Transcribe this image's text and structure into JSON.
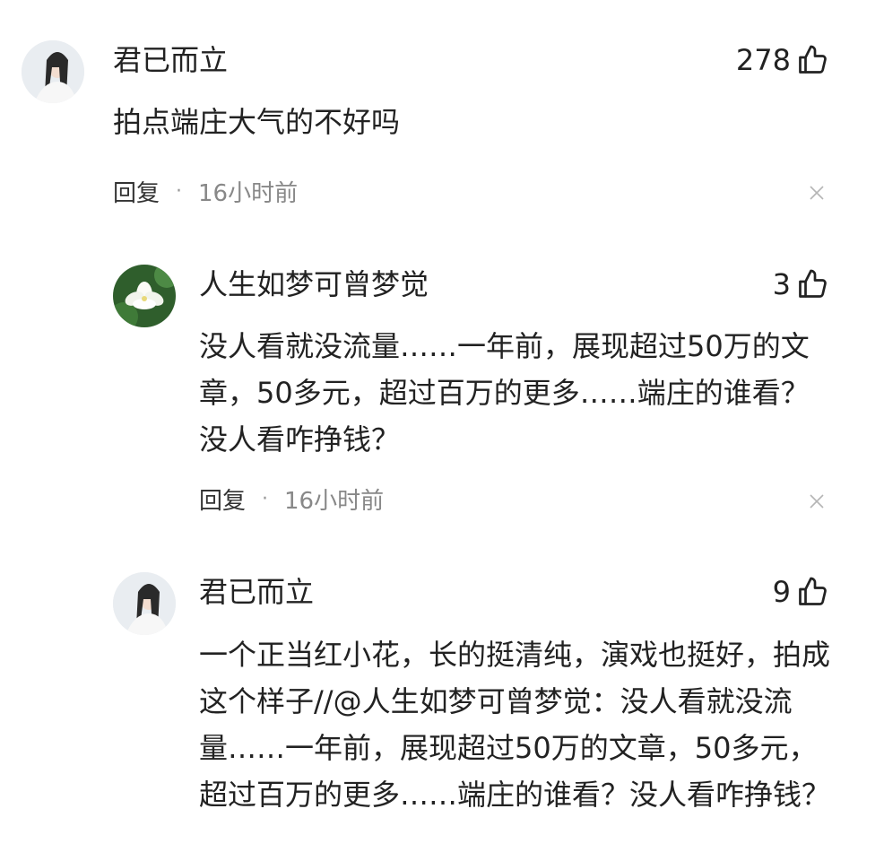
{
  "comments": [
    {
      "author": "君已而立",
      "likes": "278",
      "text": "拍点端庄大气的不好吗",
      "reply_label": "回复",
      "separator": "·",
      "time": "16小时前",
      "avatar_icon": "user-avatar"
    },
    {
      "author": "人生如梦可曾梦觉",
      "likes": "3",
      "text": "没人看就没流量……一年前，展现超过50万的文章，50多元，超过百万的更多……端庄的谁看？没人看咋挣钱？",
      "reply_label": "回复",
      "separator": "·",
      "time": "16小时前",
      "avatar_icon": "lotus-avatar"
    },
    {
      "author": "君已而立",
      "likes": "9",
      "text": "一个正当红小花，长的挺清纯，演戏也挺好，拍成这个样子//@人生如梦可曾梦觉：没人看就没流量……一年前，展现超过50万的文章，50多元，超过百万的更多……端庄的谁看？没人看咋挣钱？",
      "avatar_icon": "user-avatar"
    }
  ],
  "icons": {
    "like": "thumbs-up-icon",
    "close": "close-icon"
  }
}
